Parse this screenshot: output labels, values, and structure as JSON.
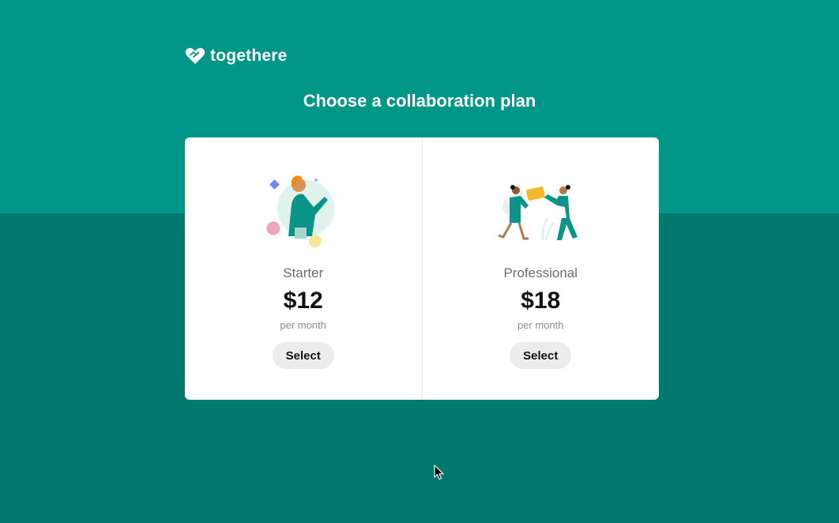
{
  "brand": {
    "name": "togethere",
    "icon": "heart-handshake-icon"
  },
  "heading": "Choose a collaboration plan",
  "plans": [
    {
      "name": "Starter",
      "price": "$12",
      "period": "per month",
      "button_label": "Select",
      "illustration": "person-waving-illustration"
    },
    {
      "name": "Professional",
      "price": "$18",
      "period": "per month",
      "button_label": "Select",
      "illustration": "two-people-sharing-illustration"
    }
  ],
  "colors": {
    "background_top": "#009788",
    "background_bottom": "#00796f",
    "card": "#ffffff",
    "button": "#ececec"
  }
}
